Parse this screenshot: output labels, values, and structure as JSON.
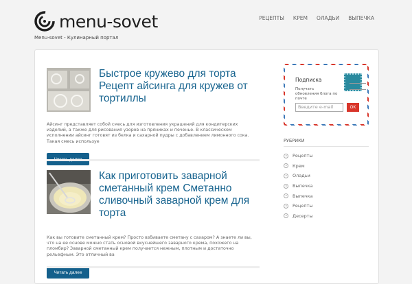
{
  "header": {
    "logo_text": "menu-sovet",
    "tagline": "Menu-sovet - Кулинарный портал"
  },
  "nav": {
    "items": [
      {
        "label": "РЕЦЕПТЫ"
      },
      {
        "label": "КРЕМ"
      },
      {
        "label": "ОЛАДЬИ"
      },
      {
        "label": "ВЫПЕЧКА"
      }
    ]
  },
  "posts": [
    {
      "title": "Быстрое кружево для торта Рецепт айсинга для кружев от тортиллы",
      "excerpt": "Айсинг представляет собой смесь для изготовления украшений для кондитерских изделий, а также для рисования узоров на пряниках и печенье. В классическом исполнении айсинг готовят из белка и сахарной пудры с добавлением лимонного сока. Такая смесь используе",
      "button_label": "Читать далее",
      "thumb_icon": "lace-cake-image"
    },
    {
      "title": "Как приготовить заварной сметанный крем Сметанно сливочный заварной крем для торта",
      "excerpt": "Как вы готовите сметанный крем? Просто взбиваете сметану с сахаром? А знаете ли вы, что на ее основе можно стать основой вкуснейшего заварного крема, похожего на пломбир? Заварной сметанный крем получается нежным, плотным и достаточно рельефным. Это отличный ва",
      "button_label": "Читать далее",
      "thumb_icon": "cream-bowl-image"
    }
  ],
  "subscribe": {
    "title": "Подписка",
    "text": "Получать обновления блога по почте",
    "email_placeholder": "Введите e-mail",
    "ok_label": "OK"
  },
  "categories": {
    "title": "РУБРИКИ",
    "items": [
      {
        "label": "Рецепты"
      },
      {
        "label": "Крем"
      },
      {
        "label": "Оладьи"
      },
      {
        "label": "Выпечка"
      },
      {
        "label": "Выпечка"
      },
      {
        "label": "Рецепты"
      },
      {
        "label": "Десерты"
      }
    ]
  },
  "colors": {
    "accent": "#14608c",
    "title": "#18648f",
    "stripe_red": "#d8352a",
    "stripe_blue": "#3b78b8"
  }
}
